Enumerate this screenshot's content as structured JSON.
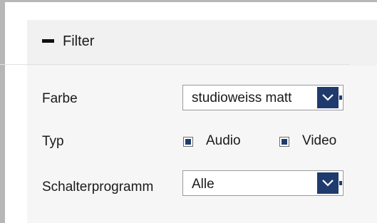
{
  "filter": {
    "title": "Filter",
    "rows": {
      "farbe": {
        "label": "Farbe",
        "value": "studioweiss matt"
      },
      "typ": {
        "label": "Typ",
        "options": [
          {
            "label": "Audio",
            "checked": true
          },
          {
            "label": "Video",
            "checked": true
          }
        ]
      },
      "schalterprogramm": {
        "label": "Schalterprogramm",
        "value": "Alle"
      }
    }
  },
  "icons": {
    "collapse": "minus-icon",
    "dropdown": "chevron-down-icon",
    "checkbox": "checkbox-checked-icon"
  },
  "colors": {
    "accent": "#1f3b6d",
    "panel_bg": "#f6f6f6",
    "header_bg": "#f1f1f1",
    "frame_border": "#b7b7b7"
  }
}
